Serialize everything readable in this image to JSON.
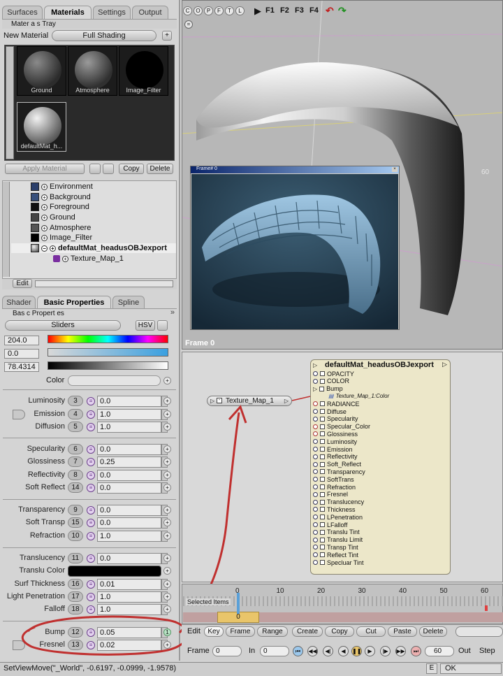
{
  "tabs": [
    {
      "label": "Surfaces",
      "active": false
    },
    {
      "label": "Materials",
      "active": true
    },
    {
      "label": "Settings",
      "active": false
    },
    {
      "label": "Output",
      "active": false
    }
  ],
  "tray": {
    "title": "Mater a s Tray",
    "new_material": "New Material",
    "shading": "Full Shading",
    "apply": "Apply Material",
    "copy": "Copy",
    "delete": "Delete"
  },
  "thumbs": [
    "Ground",
    "Atmosphere",
    "Image_Filter",
    "defaultMat_h..."
  ],
  "tree": {
    "items": [
      "Environment",
      "Background",
      "Foreground",
      "Ground",
      "Atmosphere",
      "Image_Filter",
      "defaultMat_headusOBJexport",
      "Texture_Map_1"
    ],
    "edit": "Edit"
  },
  "shader_tabs": [
    "Shader",
    "Basic Properties",
    "Spline"
  ],
  "basic": {
    "title": "Bas c Propert es",
    "sliders": "Sliders",
    "mode": "HSV",
    "hue": "204.0",
    "sat": "0.0",
    "val": "78.4314",
    "color_label": "Color"
  },
  "props": [
    {
      "label": "Luminosity",
      "num": "3",
      "val": "0.0"
    },
    {
      "label": "Emission",
      "num": "4",
      "val": "1.0"
    },
    {
      "label": "Diffusion",
      "num": "5",
      "val": "1.0"
    },
    {
      "label": "Specularity",
      "num": "6",
      "val": "0.0"
    },
    {
      "label": "Glossiness",
      "num": "7",
      "val": "0.25"
    },
    {
      "label": "Reflectivity",
      "num": "8",
      "val": "0.0"
    },
    {
      "label": "Soft Reflect",
      "num": "14",
      "val": "0.0"
    },
    {
      "label": "Transparency",
      "num": "9",
      "val": "0.0"
    },
    {
      "label": "Soft Transp",
      "num": "15",
      "val": "0.0"
    },
    {
      "label": "Refraction",
      "num": "10",
      "val": "1.0"
    },
    {
      "label": "Translucency",
      "num": "11",
      "val": "0.0"
    },
    {
      "label": "Translu Color",
      "num": "",
      "val": ""
    },
    {
      "label": "Surf Thickness",
      "num": "16",
      "val": "0.01"
    },
    {
      "label": "Light Penetration",
      "num": "17",
      "val": "1.0"
    },
    {
      "label": "Falloff",
      "num": "18",
      "val": "1.0"
    },
    {
      "label": "Bump",
      "num": "12",
      "val": "0.05"
    },
    {
      "label": "Fresnel",
      "num": "13",
      "val": "0.02"
    }
  ],
  "toolbar": {
    "letters": [
      "C",
      "O",
      "P",
      "F",
      "T",
      "L"
    ],
    "fkeys": [
      "F1",
      "F2",
      "F3",
      "F4"
    ]
  },
  "viewport": {
    "frame_label": "Frame 0",
    "render_window_title": "Frame# 0",
    "axis_tick": "60"
  },
  "node_editor": {
    "texture_node": "Texture_Map_1",
    "material_node": "defaultMat_headusOBJexport",
    "channels": [
      "OPACITY",
      "COLOR",
      "Bump",
      "Texture_Map_1:Color",
      "RADIANCE",
      "Diffuse",
      "Specularity",
      "Specular_Color",
      "Glossiness",
      "Luminosity",
      "Emission",
      "Reflectivity",
      "Soft_Reflect",
      "Transparency",
      "SoftTrans",
      "Refraction",
      "Fresnel",
      "Translucency",
      "Thickness",
      "LPenetration",
      "LFalloff",
      "Translu Tint",
      "Translu Limit",
      "Transp Tint",
      "Reflect Tint",
      "Specluar Tint"
    ]
  },
  "timeline": {
    "ticks": [
      "0",
      "10",
      "20",
      "30",
      "40",
      "50",
      "60"
    ],
    "selected": "Selected Items",
    "current": "0",
    "edit": "Edit",
    "buttons": [
      "Key",
      "Frame",
      "Range",
      "Create",
      "Copy",
      "Cut",
      "Paste",
      "Delete"
    ],
    "frame_label": "Frame",
    "frame_val": "0",
    "in_label": "In",
    "in_val": "0",
    "out_val": "60",
    "out_label": "Out",
    "step_label": "Step"
  },
  "status": {
    "text": "SetViewMove(\"_World\", -0.6197, -0.0999, -1.9578)",
    "e": "E",
    "ok": "OK"
  },
  "colors": {
    "annotation": "#c0302f",
    "node_bg": "#ece7c9",
    "render_bg": "#2c4658"
  }
}
